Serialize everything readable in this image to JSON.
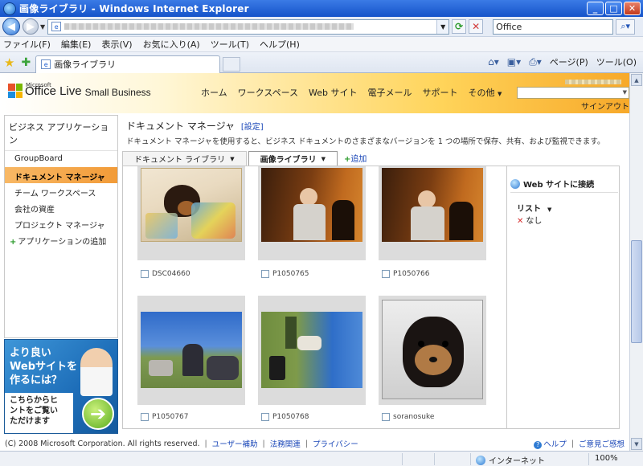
{
  "window": {
    "title": "画像ライブラリ - Windows Internet Explorer",
    "minimize_label": "_",
    "maximize_label": "□",
    "close_label": "✕"
  },
  "address": {
    "search_value": "Office"
  },
  "menu": [
    "ファイル(F)",
    "編集(E)",
    "表示(V)",
    "お気に入り(A)",
    "ツール(T)",
    "ヘルプ(H)"
  ],
  "tab": {
    "label": "画像ライブラリ"
  },
  "commands": {
    "page_label": "ページ(P)",
    "tools_label": "ツール(O)"
  },
  "site": {
    "logo_ms": "Microsoft",
    "logo_office_live": "Office Live",
    "logo_small_business": "Small Business",
    "nav": [
      "ホーム",
      "ワークスペース",
      "Web サイト",
      "電子メール",
      "サポート",
      "その他"
    ],
    "signout": "サインアウト"
  },
  "sidebar": {
    "title": "ビジネス アプリケーション",
    "items": [
      "GroupBoard",
      "ドキュメント マネージャ",
      "チーム ワークスペース",
      "会社の資産",
      "プロジェクト マネージャ"
    ],
    "add_label": "アプリケーションの追加"
  },
  "ad": {
    "headline": [
      "より良い",
      "Webサイトを",
      "作るには？"
    ],
    "body": [
      "こちらからヒ",
      "ントをご覧い",
      "ただけます"
    ],
    "arrow": "➔"
  },
  "main": {
    "title": "ドキュメント マネージャ",
    "settings_link": "[設定]",
    "description": "ドキュメント マネージャを使用すると、ビジネス ドキュメントのさまざまなバージョンを 1 つの場所で保存、共有、および監視できます。",
    "tabs": [
      "ドキュメント ライブラリ",
      "画像ライブラリ"
    ],
    "add_tab_label": "追加",
    "images": [
      {
        "caption": "DSC04660"
      },
      {
        "caption": "P1050765"
      },
      {
        "caption": "P1050766"
      },
      {
        "caption": "P1050767"
      },
      {
        "caption": "P1050768"
      },
      {
        "caption": "soranosuke"
      }
    ]
  },
  "panel": {
    "heading": "Web サイトに接続",
    "list_label": "リスト",
    "none_label": "なし"
  },
  "footer": {
    "copyright": "(C) 2008 Microsoft Corporation. All rights reserved.",
    "links": [
      "ユーザー補助",
      "法務関連",
      "プライバシー"
    ],
    "help": "ヘルプ",
    "feedback": "ご意見ご感想"
  },
  "status": {
    "zone": "インターネット",
    "zoom": "100%"
  }
}
